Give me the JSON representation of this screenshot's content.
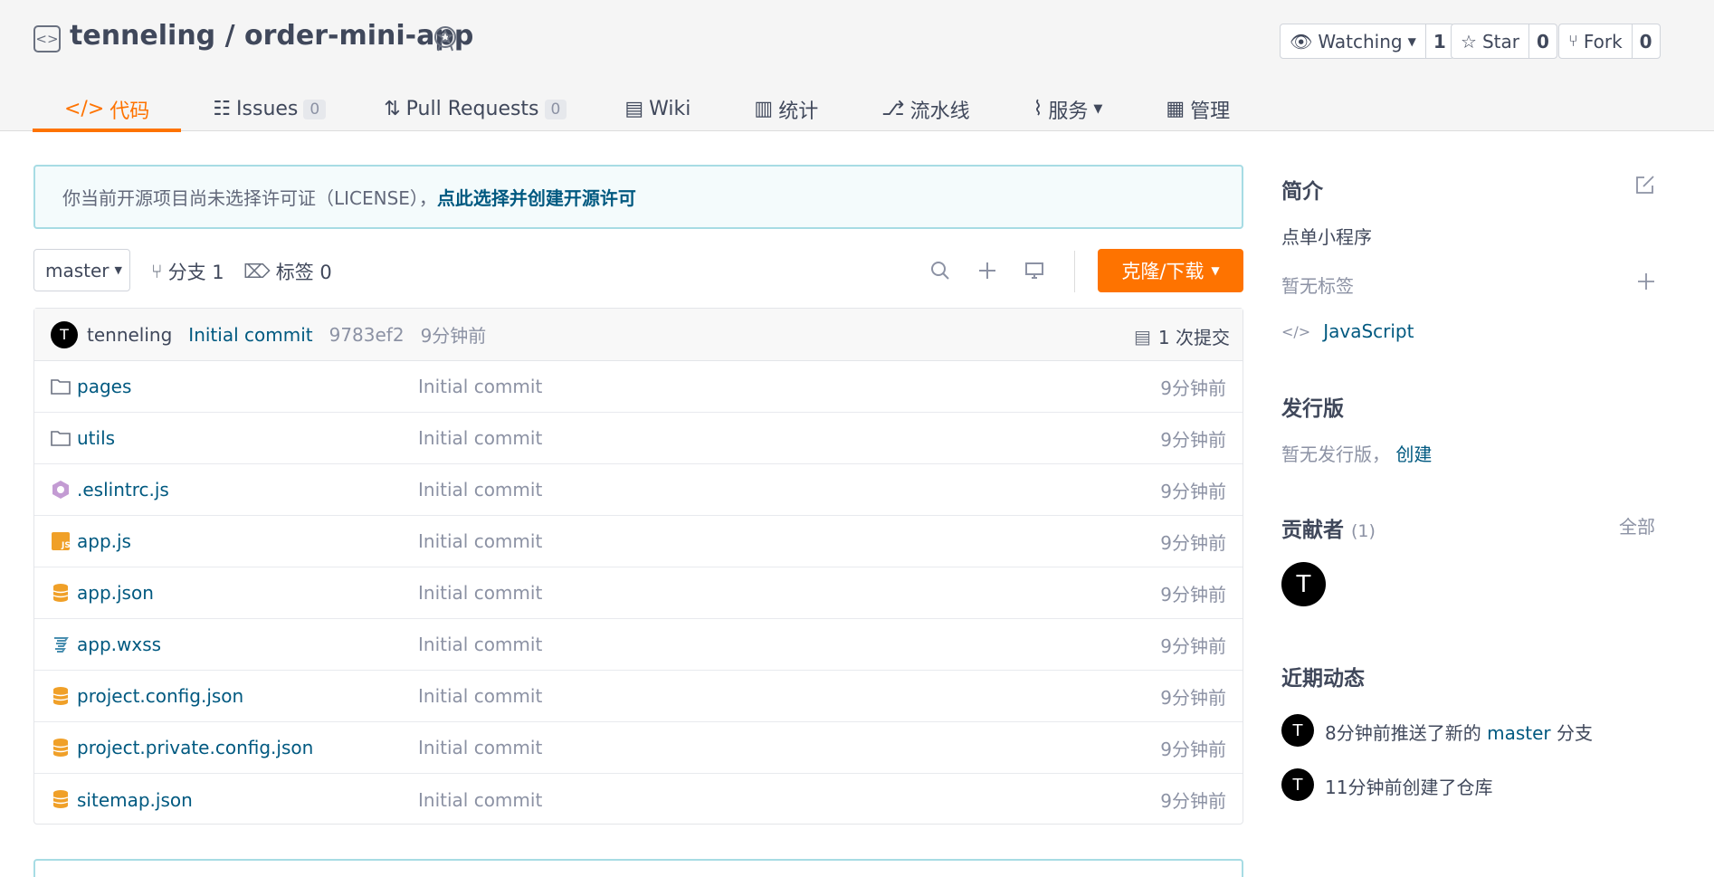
{
  "repo": {
    "owner": "tenneling",
    "separator": " / ",
    "name": "order-mini-app",
    "full_title": "tenneling / order-mini-app"
  },
  "actions": {
    "watch_label": "Watching",
    "watch_count": "1",
    "star_label": "Star",
    "star_count": "0",
    "fork_label": "Fork",
    "fork_count": "0"
  },
  "tabs": [
    {
      "label": "代码",
      "icon": "code-icon",
      "active": true
    },
    {
      "label": "Issues",
      "icon": "issues-icon",
      "count": "0"
    },
    {
      "label": "Pull Requests",
      "icon": "pull-request-icon",
      "count": "0"
    },
    {
      "label": "Wiki",
      "icon": "book-icon"
    },
    {
      "label": "统计",
      "icon": "bar-chart-icon"
    },
    {
      "label": "流水线",
      "icon": "pipeline-icon"
    },
    {
      "label": "服务",
      "icon": "pulse-icon"
    },
    {
      "label": "管理",
      "icon": "settings-doc-icon"
    }
  ],
  "notice": {
    "text": "你当前开源项目尚未选择许可证（LICENSE），",
    "link": "点此选择并创建开源许可"
  },
  "toolbar": {
    "branch": "master",
    "branches": "分支 1",
    "tags": "标签 0",
    "clone_label": "克隆/下载"
  },
  "commit": {
    "avatar": "T",
    "author": "tenneling",
    "message": "Initial commit",
    "hash": "9783ef2",
    "time": "9分钟前",
    "count": "1 次提交"
  },
  "files": [
    {
      "name": "pages",
      "icon": "folder-icon",
      "message": "Initial commit",
      "time": "9分钟前"
    },
    {
      "name": "utils",
      "icon": "folder-icon",
      "message": "Initial commit",
      "time": "9分钟前"
    },
    {
      "name": ".eslintrc.js",
      "icon": "eslint-icon",
      "message": "Initial commit",
      "time": "9分钟前"
    },
    {
      "name": "app.js",
      "icon": "js-icon",
      "message": "Initial commit",
      "time": "9分钟前"
    },
    {
      "name": "app.json",
      "icon": "json-icon",
      "message": "Initial commit",
      "time": "9分钟前"
    },
    {
      "name": "app.wxss",
      "icon": "css-icon",
      "message": "Initial commit",
      "time": "9分钟前"
    },
    {
      "name": "project.config.json",
      "icon": "json-icon",
      "message": "Initial commit",
      "time": "9分钟前"
    },
    {
      "name": "project.private.config.json",
      "icon": "json-icon",
      "message": "Initial commit",
      "time": "9分钟前"
    },
    {
      "name": "sitemap.json",
      "icon": "json-icon",
      "message": "Initial commit",
      "time": "9分钟前"
    }
  ],
  "sidebar": {
    "intro_title": "简介",
    "intro_text": "点单小程序",
    "no_tags": "暂无标签",
    "language": "JavaScript",
    "release_title": "发行版",
    "no_release": "暂无发行版，",
    "create_link": "创建",
    "contributors_title": "贡献者",
    "contributors_count": "(1)",
    "all_link": "全部",
    "contributor_avatar": "T",
    "activity_title": "近期动态",
    "activities": [
      {
        "avatar": "T",
        "prefix": "8分钟前推送了新的",
        "branch": "master",
        "suffix": "分支"
      },
      {
        "avatar": "T",
        "text": "11分钟前创建了仓库"
      }
    ]
  },
  "colors": {
    "accent": "#fe7300",
    "link": "#005980",
    "muted": "#8c92a4",
    "text": "#40485b"
  }
}
